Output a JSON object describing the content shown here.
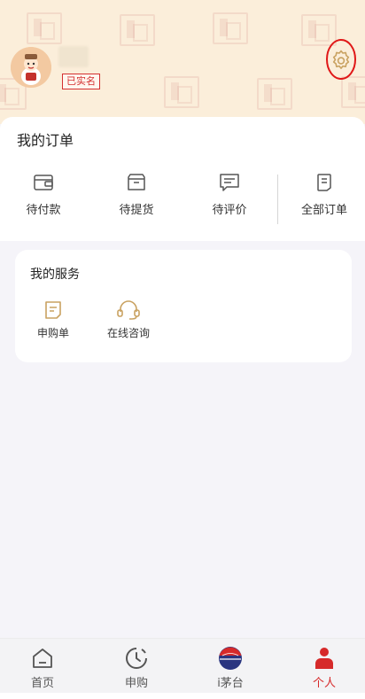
{
  "header": {
    "realname_badge": "已实名"
  },
  "orders": {
    "title": "我的订单",
    "items": [
      {
        "label": "待付款",
        "icon": "wallet-icon"
      },
      {
        "label": "待提货",
        "icon": "package-icon"
      },
      {
        "label": "待评价",
        "icon": "comment-icon"
      },
      {
        "label": "全部订单",
        "icon": "order-list-icon"
      }
    ]
  },
  "services": {
    "title": "我的服务",
    "items": [
      {
        "label": "申购单",
        "icon": "form-icon"
      },
      {
        "label": "在线咨询",
        "icon": "headset-icon"
      }
    ]
  },
  "nav": {
    "items": [
      {
        "label": "首页",
        "icon": "home-icon"
      },
      {
        "label": "申购",
        "icon": "clock-icon"
      },
      {
        "label": "i茅台",
        "icon": "moutai-logo-icon"
      },
      {
        "label": "个人",
        "icon": "person-icon"
      }
    ]
  },
  "colors": {
    "header_bg": "#fbeeda",
    "accent_gold": "#c9a261",
    "accent_red": "#d62a2a"
  }
}
